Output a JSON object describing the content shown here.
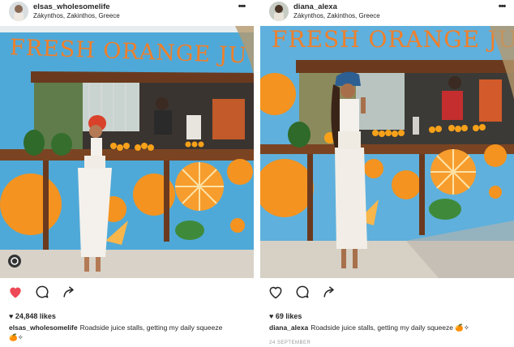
{
  "posts": [
    {
      "username": "elsas_wholesomelife",
      "location": "Zákynthos, Zakinthos, Greece",
      "sign": "FRESH ORANGE JU",
      "liked": true,
      "likes": "24,848 likes",
      "caption_user": "elsas_wholesomelife",
      "caption_text": "Roadside juice stalls, getting my daily squeeze 🍊✧",
      "timestamp": ""
    },
    {
      "username": "diana_alexa",
      "location": "Zákynthos, Zakinthos, Greece",
      "sign": "FRESH ORANGE JUI",
      "liked": false,
      "likes": "69 likes",
      "caption_user": "diana_alexa",
      "caption_text": "Roadside juice stalls, getting my daily squeeze 🍊✧",
      "timestamp": "24 SEPTEMBER"
    }
  ],
  "colors": {
    "like_red": "#ed4956",
    "stall_blue": "#4fa9d8",
    "orange": "#f4931f",
    "wood": "#6b3a1e"
  }
}
